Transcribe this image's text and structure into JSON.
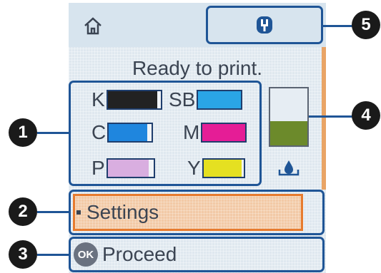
{
  "status_text": "Ready to print.",
  "inks": [
    {
      "label": "K",
      "color": "#222222",
      "level": 0.93
    },
    {
      "label": "SB",
      "color": "#2aa5e6",
      "level": 1.0
    },
    {
      "label": "C",
      "color": "#1f86de",
      "level": 0.9
    },
    {
      "label": "M",
      "color": "#e51d96",
      "level": 1.0
    },
    {
      "label": "P",
      "color": "#d9aee0",
      "level": 0.9
    },
    {
      "label": "Y",
      "color": "#e5e021",
      "level": 0.95
    }
  ],
  "maintenance_box": {
    "level": 0.43,
    "color": "#6c8a2b"
  },
  "menu": {
    "settings_label": "Settings",
    "proceed_label": "Proceed",
    "ok_label": "OK"
  },
  "callouts": [
    "1",
    "2",
    "3",
    "4",
    "5"
  ],
  "colors": {
    "accent": "#1f5596",
    "highlight": "#e77b2e"
  }
}
